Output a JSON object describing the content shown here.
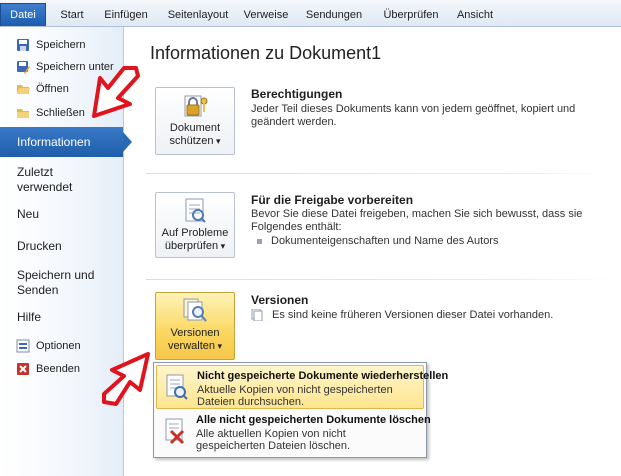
{
  "ribbon": {
    "tabs": [
      "Datei",
      "Start",
      "Einfügen",
      "Seitenlayout",
      "Verweise",
      "Sendungen",
      "Überprüfen",
      "Ansicht"
    ]
  },
  "nav": {
    "save": "Speichern",
    "save_as": "Speichern unter",
    "open": "Öffnen",
    "close": "Schließen",
    "info": "Informationen",
    "recent": "Zuletzt verwendet",
    "new": "Neu",
    "print": "Drucken",
    "save_send": "Speichern und Senden",
    "help": "Hilfe",
    "options": "Optionen",
    "exit": "Beenden"
  },
  "main": {
    "title": "Informationen zu Dokument1",
    "permissions": {
      "button": "Dokument schützen",
      "heading": "Berechtigungen",
      "text": "Jeder Teil dieses Dokuments kann von jedem geöffnet, kopiert und geändert werden."
    },
    "prepare": {
      "button": "Auf Probleme überprüfen",
      "heading": "Für die Freigabe vorbereiten",
      "text": "Bevor Sie diese Datei freigeben, machen Sie sich bewusst, dass sie Folgendes enthält:",
      "bullet": "Dokumenteigenschaften und Name des Autors"
    },
    "versions": {
      "button": "Versionen verwalten",
      "heading": "Versionen",
      "text": "Es sind keine früheren Versionen dieser Datei vorhanden."
    }
  },
  "menu": {
    "items": [
      {
        "title": "Nicht gespeicherte Dokumente wiederherstellen",
        "desc": "Aktuelle Kopien von nicht gespeicherten Dateien durchsuchen."
      },
      {
        "title": "Alle nicht gespeicherten Dokumente löschen",
        "desc": "Alle aktuellen Kopien von nicht gespeicherten Dateien löschen."
      }
    ]
  },
  "colors": {
    "accent": "#2a69b6",
    "highlight": "#fbd760",
    "annotation": "#e0141e"
  }
}
